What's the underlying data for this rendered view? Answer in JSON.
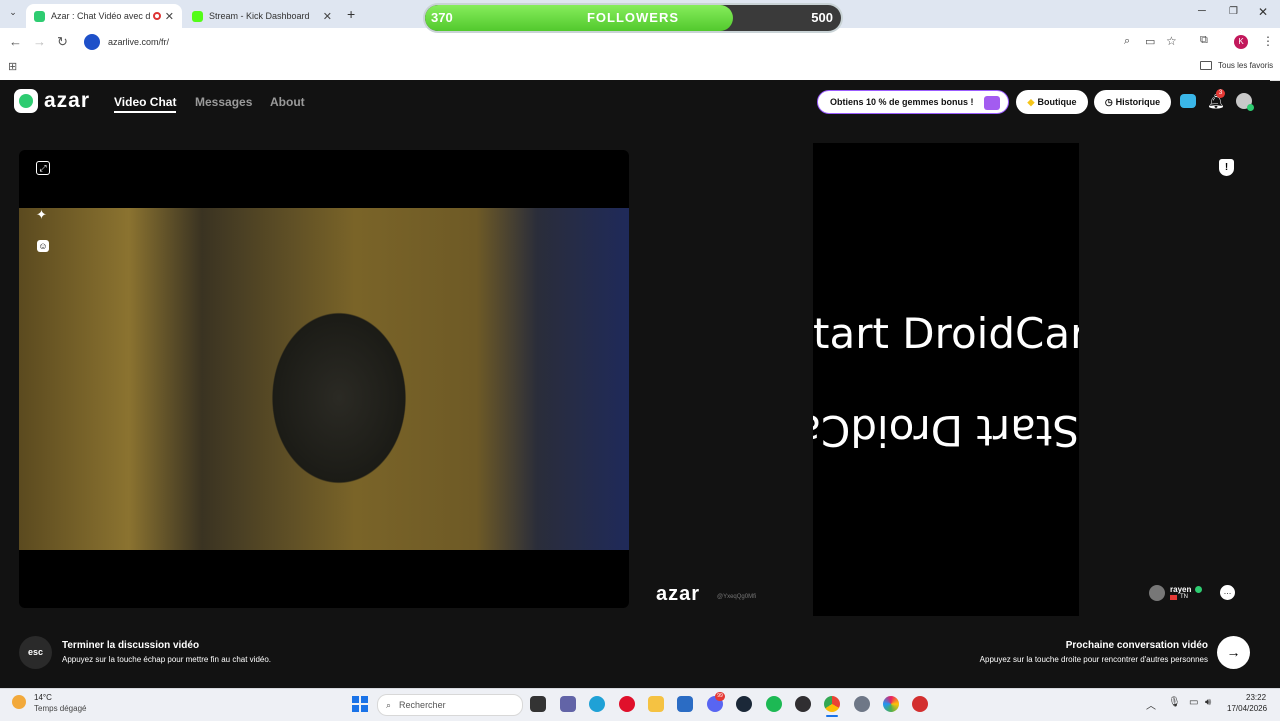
{
  "browser": {
    "tabs": [
      {
        "title": "Azar : Chat Vidéo avec de n",
        "active": true
      },
      {
        "title": "Stream - Kick Dashboard",
        "active": false
      }
    ],
    "url": "azarlive.com/fr/",
    "bookmarks_label": "Tous les favoris",
    "profile_initial": "K"
  },
  "followers": {
    "current": "370",
    "label": "FOLLOWERS",
    "goal": "500",
    "progress": 0.74
  },
  "azar": {
    "logo": "azar",
    "nav": [
      "Video Chat",
      "Messages",
      "About"
    ],
    "promo": "Obtiens 10 % de gemmes bonus !",
    "shop": "Boutique",
    "history": "Historique",
    "notification_count": "3"
  },
  "video": {
    "droid_top": "tart DroidCar",
    "droid_bottom": "Start DroidCam",
    "watermark": "azar",
    "watermark_id": "@YxeqQg0Mfi",
    "peer_name": "rayen",
    "peer_country": "TN"
  },
  "bottom": {
    "esc_key": "esc",
    "end_title": "Terminer la discussion vidéo",
    "end_desc": "Appuyez sur la touche échap pour mettre fin au chat vidéo.",
    "next_title": "Prochaine conversation vidéo",
    "next_desc": "Appuyez sur la touche droite pour rencontrer d'autres personnes"
  },
  "taskbar": {
    "temp": "14°C",
    "weather": "Temps dégagé",
    "search": "Rechercher",
    "time": "23:22",
    "date": "17/04/2026",
    "badge": "99"
  },
  "colors": {
    "accent_green": "#52c92d",
    "azar_green": "#2ecc71"
  }
}
